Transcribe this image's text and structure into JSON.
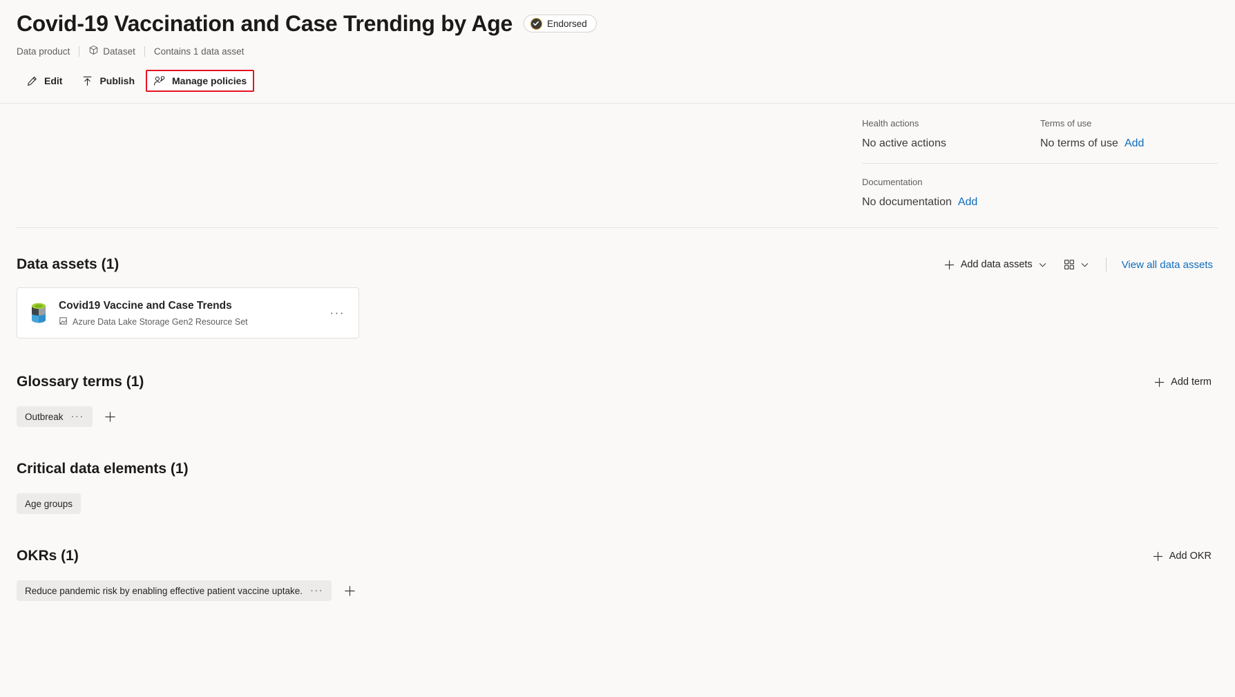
{
  "header": {
    "title": "Covid-19 Vaccination and Case Trending by Age",
    "endorsed_badge": {
      "label": "Endorsed",
      "icon": "check-circle-icon"
    },
    "subtitle": {
      "type_label": "Data product",
      "kind_label": "Dataset",
      "kind_icon": "cube-icon",
      "contains_label": "Contains 1 data asset"
    }
  },
  "commandbar": {
    "edit": {
      "label": "Edit",
      "icon": "pencil-icon"
    },
    "publish": {
      "label": "Publish",
      "icon": "publish-arrow-icon"
    },
    "manage_policies": {
      "label": "Manage policies",
      "icon": "person-key-icon",
      "highlight_color": "#e81123"
    }
  },
  "info": {
    "health_actions": {
      "label": "Health actions",
      "value": "No active actions"
    },
    "terms_of_use": {
      "label": "Terms of use",
      "value": "No terms of use",
      "action": "Add"
    },
    "documentation": {
      "label": "Documentation",
      "value": "No documentation",
      "action": "Add"
    }
  },
  "data_assets": {
    "title": "Data assets (1)",
    "actions": {
      "add": "Add data assets",
      "view_all": "View all data assets"
    },
    "items": [
      {
        "name": "Covid19 Vaccine and Case Trends",
        "type": "Azure Data Lake Storage Gen2 Resource Set",
        "icon": "azure-data-lake-icon",
        "more": "···"
      }
    ]
  },
  "glossary_terms": {
    "title": "Glossary terms (1)",
    "add_action": "Add term",
    "items": [
      {
        "label": "Outbreak",
        "more": "···"
      }
    ]
  },
  "critical_data_elements": {
    "title": "Critical data elements (1)",
    "items": [
      {
        "label": "Age groups"
      }
    ]
  },
  "okrs": {
    "title": "OKRs (1)",
    "add_action": "Add OKR",
    "items": [
      {
        "label": "Reduce pandemic risk by enabling effective patient vaccine uptake.",
        "more": "···"
      }
    ]
  },
  "colors": {
    "accent_link": "#0f6cbd",
    "highlight_red": "#e81123",
    "background": "#faf9f8",
    "chip_bg": "#edebe9"
  }
}
